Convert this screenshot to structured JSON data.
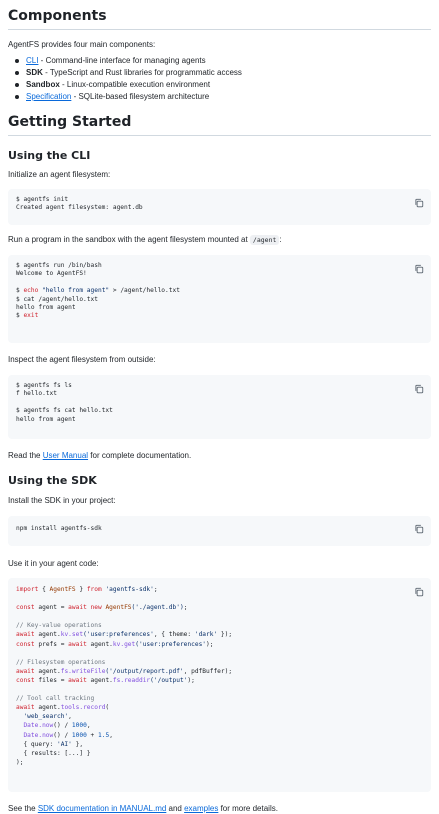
{
  "components": {
    "heading": "Components",
    "intro": "AgentFS provides four main components:",
    "items": [
      {
        "name": "CLI",
        "linked": true,
        "desc": " - Command-line interface for managing agents"
      },
      {
        "name": "SDK",
        "linked": false,
        "desc": " - TypeScript and Rust libraries for programmatic access"
      },
      {
        "name": "Sandbox",
        "linked": false,
        "desc": " - Linux-compatible execution environment"
      },
      {
        "name": "Specification",
        "linked": true,
        "desc": " - SQLite-based filesystem architecture"
      }
    ]
  },
  "getting_started": {
    "heading": "Getting Started",
    "cli": {
      "heading": "Using the CLI",
      "step1": "Initialize an agent filesystem:",
      "code1": [
        "$ agentfs init",
        "Created agent filesystem: agent.db"
      ],
      "step2_prefix": "Run a program in the sandbox with the agent filesystem mounted at ",
      "step2_code": "/agent",
      "step2_suffix": ":",
      "code2": {
        "l1": "$ agentfs run /bin/bash",
        "l2": "Welcome to AgentFS!",
        "l3a": "$ ",
        "l3echo": "echo",
        "l3str": " \"hello from agent\"",
        "l3rest": " > /agent/hello.txt",
        "l4": "$ cat /agent/hello.txt",
        "l5": "hello from agent",
        "l6a": "$ ",
        "l6exit": "exit"
      },
      "step3": "Inspect the agent filesystem from outside:",
      "code3": [
        "$ agentfs fs ls",
        "f hello.txt",
        "",
        "$ agentfs fs cat hello.txt",
        "hello from agent"
      ],
      "read_prefix": "Read the ",
      "read_link": "User Manual",
      "read_suffix": " for complete documentation."
    },
    "sdk": {
      "heading": "Using the SDK",
      "step1": "Install the SDK in your project:",
      "install_code": "npm install agentfs-sdk",
      "step2": "Use it in your agent code:",
      "see_prefix": "See the ",
      "see_link1": "SDK documentation in MANUAL.md",
      "see_mid": " and ",
      "see_link2": "examples",
      "see_suffix": " for more details."
    }
  },
  "sdk_code": {
    "import_kw": "import",
    "import_open": " { ",
    "import_cls": "AgentFS",
    "import_close": " } ",
    "from_kw": "from",
    "import_str": " 'agentfs-sdk'",
    "semi": ";",
    "const1": "const",
    "agent_var": " agent = ",
    "await_kw0": "await",
    "new_kw": " new ",
    "agent_cls": "AgentFS",
    "agent_arg": "('./agent.db')",
    "comment_kv": "// Key-value operations",
    "kv_set_pre": " agent.",
    "kv_set_fn": "kv.set",
    "kv_set_str": "('user:preferences'",
    "kv_set_obj": ", { theme: ",
    "kv_set_dark": "'dark'",
    "kv_set_end": " });",
    "prefs_pre": " prefs = ",
    "kv_get_pre": " agent.",
    "kv_get_fn": "kv.get",
    "kv_get_str": "('user:preferences'",
    "kv_get_end": ");",
    "comment_fs": "// Filesystem operations",
    "fs_write_fn": "fs.writeFile",
    "fs_write_str": "('/output/report.pdf'",
    "fs_write_end": ", pdfBuffer);",
    "files_pre": " files = ",
    "fs_read_fn": "fs.readdir",
    "fs_read_str": "('/output'",
    "comment_tool": "// Tool call tracking",
    "tools_fn": "tools.record",
    "tools_open": "(",
    "tool_name": "'web_search'",
    "date1_fn": "Date.now",
    "date1_rest": "() / ",
    "num1000": "1000",
    "date2_rest": "() / ",
    "num1000b": "1000",
    "plus": " + ",
    "num15": "1.5",
    "query_pre": "{ query: ",
    "query_str": "'AI'",
    "query_end": " },",
    "results": "{ results: [...] }",
    "close": ");",
    "await_kw": "await"
  },
  "icons": {
    "copy": "copy-icon"
  },
  "colors": {
    "link": "#0969da",
    "code_bg": "#f6f8fa",
    "keyword": "#cf222e",
    "string": "#0a3069",
    "comment": "#6e7781"
  }
}
